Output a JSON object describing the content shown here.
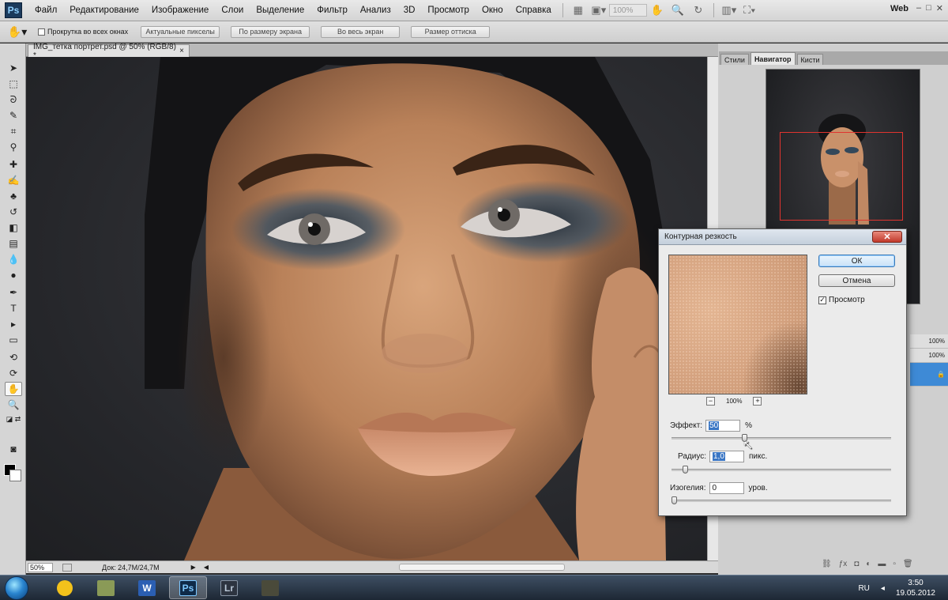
{
  "menubar": {
    "logo": "Ps",
    "items": [
      "Файл",
      "Редактирование",
      "Изображение",
      "Слои",
      "Выделение",
      "Фильтр",
      "Анализ",
      "3D",
      "Просмотр",
      "Окно",
      "Справка"
    ],
    "zoom": "100%",
    "workspace": "Web",
    "window_buttons": [
      "–",
      "□",
      "✕"
    ]
  },
  "options_bar": {
    "scroll_all_windows": "Прокрутка во всех окнах",
    "buttons": [
      "Актуальные пикселы",
      "По размеру экрана",
      "Во весь экран",
      "Размер оттиска"
    ]
  },
  "document": {
    "tab_title": "IMG_тетка портрет.psd @ 50% (RGB/8) *",
    "tab_close": "×",
    "zoom": "50%",
    "doc_size": "Док: 24,7M/24,7M"
  },
  "panels": {
    "tabs": [
      "Стили",
      "Навигатор",
      "Кисти"
    ],
    "layer_values": [
      "100%",
      "100%"
    ],
    "lock_icon": "🔒"
  },
  "dialog": {
    "title": "Контурная резкость",
    "close": "✕",
    "ok": "ОК",
    "cancel": "Отмена",
    "preview_label": "Просмотр",
    "preview_checked": true,
    "preview_zoom": "100%",
    "zoom_minus": "−",
    "zoom_plus": "+",
    "amount_label": "Эффект:",
    "amount_value": "50",
    "amount_unit": "%",
    "amount_slider": 0.33,
    "radius_label": "Радиус:",
    "radius_value": "1,0",
    "radius_unit": "пикс.",
    "radius_slider": 0.05,
    "threshold_label": "Изогелия:",
    "threshold_value": "0",
    "threshold_unit": "уров.",
    "threshold_slider": 0.0
  },
  "taskbar": {
    "apps": [
      "",
      "",
      "W",
      "Ps",
      "Lr",
      ""
    ],
    "active_app_index": 3,
    "language": "RU",
    "time": "3:50",
    "date": "19.05.2012"
  }
}
